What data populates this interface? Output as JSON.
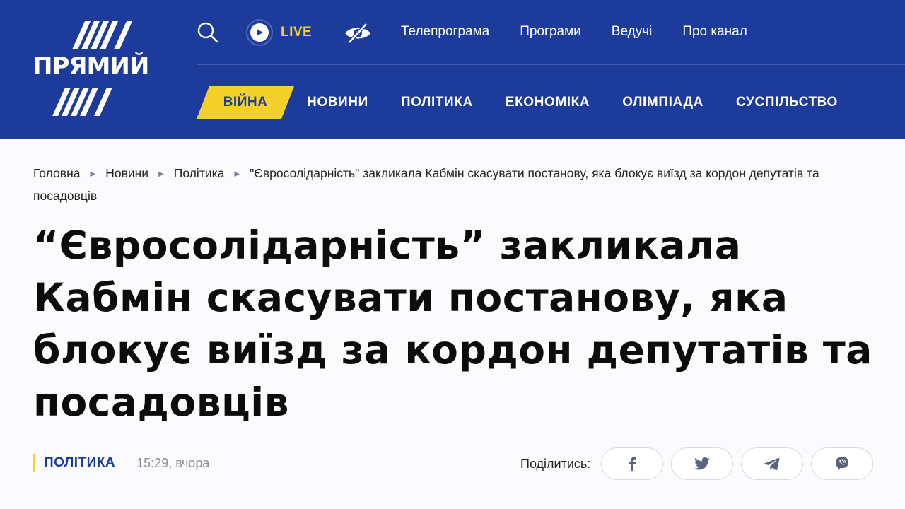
{
  "logo": {
    "text": "ПРЯМИЙ"
  },
  "topbar": {
    "live_label": "LIVE",
    "links": [
      "Телепрограма",
      "Програми",
      "Ведучі",
      "Про канал"
    ]
  },
  "mainnav": {
    "active": "ВІЙНА",
    "items": [
      "НОВИНИ",
      "ПОЛІТИКА",
      "ЕКОНОМІКА",
      "ОЛІМПІАДА",
      "СУСПІЛЬСТВО"
    ]
  },
  "breadcrumb": {
    "items": [
      "Головна",
      "Новини",
      "Політика"
    ],
    "current": "\"Євросолідарність\" закликала Кабмін скасувати постанову, яка блокує виїзд за кордон депутатів та посадовців"
  },
  "article": {
    "title": "“Євросолідарність” закликала Кабмін скасувати постанову, яка блокує виїзд за кордон депутатів та посадовців",
    "category": "ПОЛІТИКА",
    "time": "15:29, вчора"
  },
  "share": {
    "label": "Поділитись:",
    "networks": [
      "facebook-icon",
      "twitter-icon",
      "telegram-icon",
      "viber-icon"
    ]
  },
  "colors": {
    "header_bg": "#1c3b9b",
    "accent_yellow": "#f5cf2a",
    "category_blue": "#1c3b9b"
  }
}
